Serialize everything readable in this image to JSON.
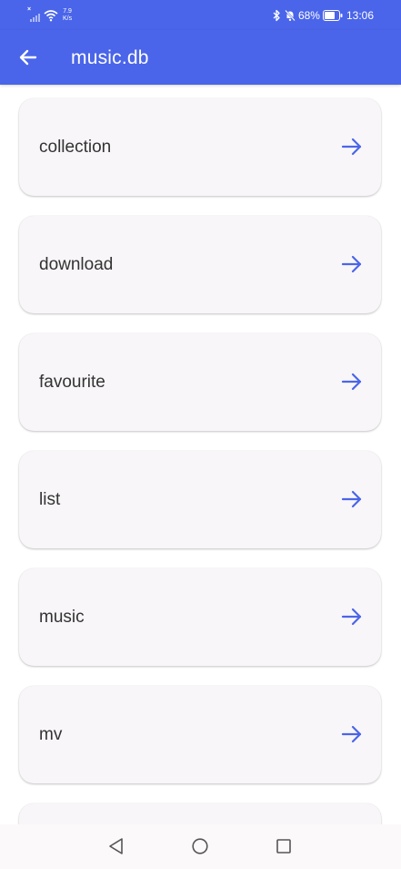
{
  "status_bar": {
    "net_speed_value": "7.9",
    "net_speed_unit": "K/s",
    "signal_mark": "×",
    "battery_percent": "68%",
    "time": "13:06",
    "icons": [
      "signal-icon",
      "wifi-icon",
      "bluetooth-icon",
      "bell-off-icon",
      "battery-icon"
    ]
  },
  "app_bar": {
    "title": "music.db",
    "back_icon": "arrow-left-icon",
    "color": "#4a65e9"
  },
  "tables": [
    {
      "label": "collection"
    },
    {
      "label": "download"
    },
    {
      "label": "favourite"
    },
    {
      "label": "list"
    },
    {
      "label": "music"
    },
    {
      "label": "mv"
    },
    {
      "label": ""
    }
  ],
  "row_arrow_icon": "arrow-right-icon",
  "accent_color": "#4a65e9",
  "nav_bar": {
    "icons": [
      "back-triangle-icon",
      "home-circle-icon",
      "recents-square-icon"
    ]
  }
}
